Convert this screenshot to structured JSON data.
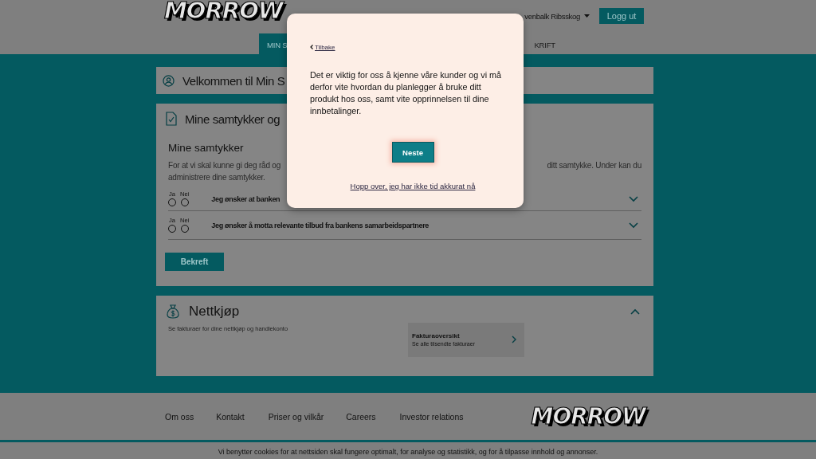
{
  "header": {
    "logo": "MORROW",
    "user": "venbalk Ribsskog",
    "logout": "Logg ut"
  },
  "nav": [
    {
      "label": "MIN S",
      "selected": true
    },
    {
      "label": "KRIFT",
      "selected": false
    }
  ],
  "welcome": {
    "title": "Velkommen til Min S"
  },
  "consents": {
    "title": "Mine samtykker og",
    "heading": "Mine samtykker",
    "description_left": "For at vi skal kunne gi deg råd og",
    "description_right": "ditt samtykke. Under kan du",
    "description_line2": "administrere dine samtykker.",
    "items": [
      {
        "yes_label": "Ja",
        "no_label": "Nei",
        "yes_checked": false,
        "no_checked": false,
        "text": "Jeg ønsker at banken",
        "expanded": false
      },
      {
        "yes_label": "Ja",
        "no_label": "Nei",
        "yes_checked": false,
        "no_checked": false,
        "text": "Jeg ønsker å motta relevante tilbud fra bankens samarbeidspartnere",
        "expanded": false
      }
    ],
    "confirm": "Bekreft"
  },
  "nettkjop": {
    "title": "Nettkjøp",
    "expanded": true,
    "description": "Se fakturaer for dine nettkjøp og handlekonto",
    "link": {
      "title": "Fakturaoversikt",
      "subtitle": "Se alle tilsendte fakturaer"
    }
  },
  "footer": {
    "links": [
      "Om oss",
      "Kontakt",
      "Priser og vilkår",
      "Careers",
      "Investor relations"
    ],
    "logo": "MORROW"
  },
  "cookie_notice": "Vi benytter cookies for at nettsiden skal fungere optimalt, for analyse og statistikk, og for å tilpasse innhold og annonser.",
  "modal": {
    "back": "Tilbake",
    "message": "Det er viktig for oss å kjenne våre kunder og vi må derfor vite hvordan du planlegger å bruke ditt produkt hos oss, samt vite opprinnelsen til dine innbetalinger.",
    "primary": "Neste",
    "skip": "Hopp over, jeg har ikke tid akkurat nå"
  }
}
